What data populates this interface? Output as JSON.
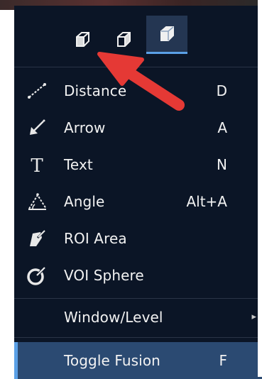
{
  "view_buttons": [
    {
      "icon": "cube-view-1-icon",
      "active": false
    },
    {
      "icon": "cube-view-2-icon",
      "active": false
    },
    {
      "icon": "cube-view-3-icon",
      "active": true
    }
  ],
  "menu_items": [
    {
      "label": "Distance",
      "shortcut": "D",
      "icon": "distance-icon"
    },
    {
      "label": "Arrow",
      "shortcut": "A",
      "icon": "arrow-tool-icon"
    },
    {
      "label": "Text",
      "shortcut": "N",
      "icon": "text-tool-icon"
    },
    {
      "label": "Angle",
      "shortcut": "Alt+A",
      "icon": "angle-icon"
    },
    {
      "label": "ROI Area",
      "shortcut": "",
      "icon": "roi-area-icon"
    },
    {
      "label": "VOI Sphere",
      "shortcut": "",
      "icon": "voi-sphere-icon"
    }
  ],
  "submenu_item": {
    "label": "Window/Level",
    "chevron": "▸"
  },
  "toggle_item": {
    "label": "Toggle Fusion",
    "shortcut": "F"
  },
  "colors": {
    "menu_bg": "#0b1526",
    "highlight": "#2b4a72",
    "accent": "#5aa0e6",
    "annotation_arrow": "#e53935"
  }
}
